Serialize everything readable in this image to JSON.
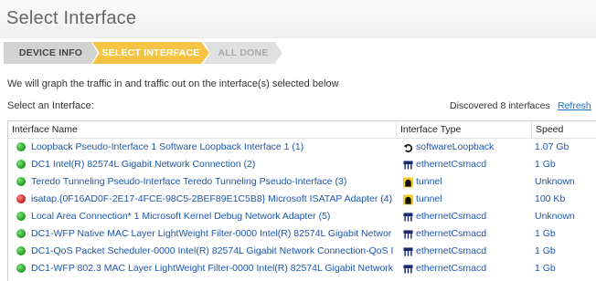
{
  "page": {
    "title": "Select Interface"
  },
  "wizard": {
    "steps": [
      {
        "label": "DEVICE INFO"
      },
      {
        "label": "SELECT INTERFACE"
      },
      {
        "label": "ALL DONE"
      }
    ]
  },
  "intro_text": "We will graph the traffic in and traffic out on the interface(s) selected below",
  "select_label": "Select an Interface:",
  "discovered_text": "Discovered 8 interfaces",
  "refresh_label": "Refresh",
  "table": {
    "columns": [
      "Interface Name",
      "Interface Type",
      "Speed"
    ],
    "rows": [
      {
        "status": "green",
        "name": "Loopback Pseudo-Interface 1 Software Loopback Interface 1 (1)",
        "type_icon": "loopback-icon",
        "type": "softwareLoopback",
        "speed": "1.07 Gb"
      },
      {
        "status": "green",
        "name": "DC1 Intel(R) 82574L Gigabit Network Connection (2)",
        "type_icon": "ethernet-icon",
        "type": "ethernetCsmacd",
        "speed": "1 Gb"
      },
      {
        "status": "green",
        "name": "Teredo Tunneling Pseudo-Interface Teredo Tunneling Pseudo-Interface (3)",
        "type_icon": "tunnel-icon",
        "type": "tunnel",
        "speed": "Unknown"
      },
      {
        "status": "red",
        "name": "isatap.{0F16AD0F-2E17-4FCE-98C5-2BEF89E1C5B8} Microsoft ISATAP Adapter (4)",
        "type_icon": "tunnel-icon",
        "type": "tunnel",
        "speed": "100 Kb"
      },
      {
        "status": "green",
        "name": "Local Area Connection* 1 Microsoft Kernel Debug Network Adapter (5)",
        "type_icon": "ethernet-icon",
        "type": "ethernetCsmacd",
        "speed": "Unknown"
      },
      {
        "status": "green",
        "name": "DC1-WFP Native MAC Layer LightWeight Filter-0000 Intel(R) 82574L Gigabit Networ",
        "type_icon": "ethernet-icon",
        "type": "ethernetCsmacd",
        "speed": "1 Gb"
      },
      {
        "status": "green",
        "name": "DC1-QoS Packet Scheduler-0000 Intel(R) 82574L Gigabit Network Connection-QoS I",
        "type_icon": "ethernet-icon",
        "type": "ethernetCsmacd",
        "speed": "1 Gb"
      },
      {
        "status": "green",
        "name": "DC1-WFP 802.3 MAC Layer LightWeight Filter-0000 Intel(R) 82574L Gigabit Network",
        "type_icon": "ethernet-icon",
        "type": "ethernetCsmacd",
        "speed": "1 Gb"
      }
    ]
  },
  "colors": {
    "active_step": "#f6c444",
    "link": "#1e56a8",
    "status_up": "#1c9a1c",
    "status_down": "#c21818"
  }
}
